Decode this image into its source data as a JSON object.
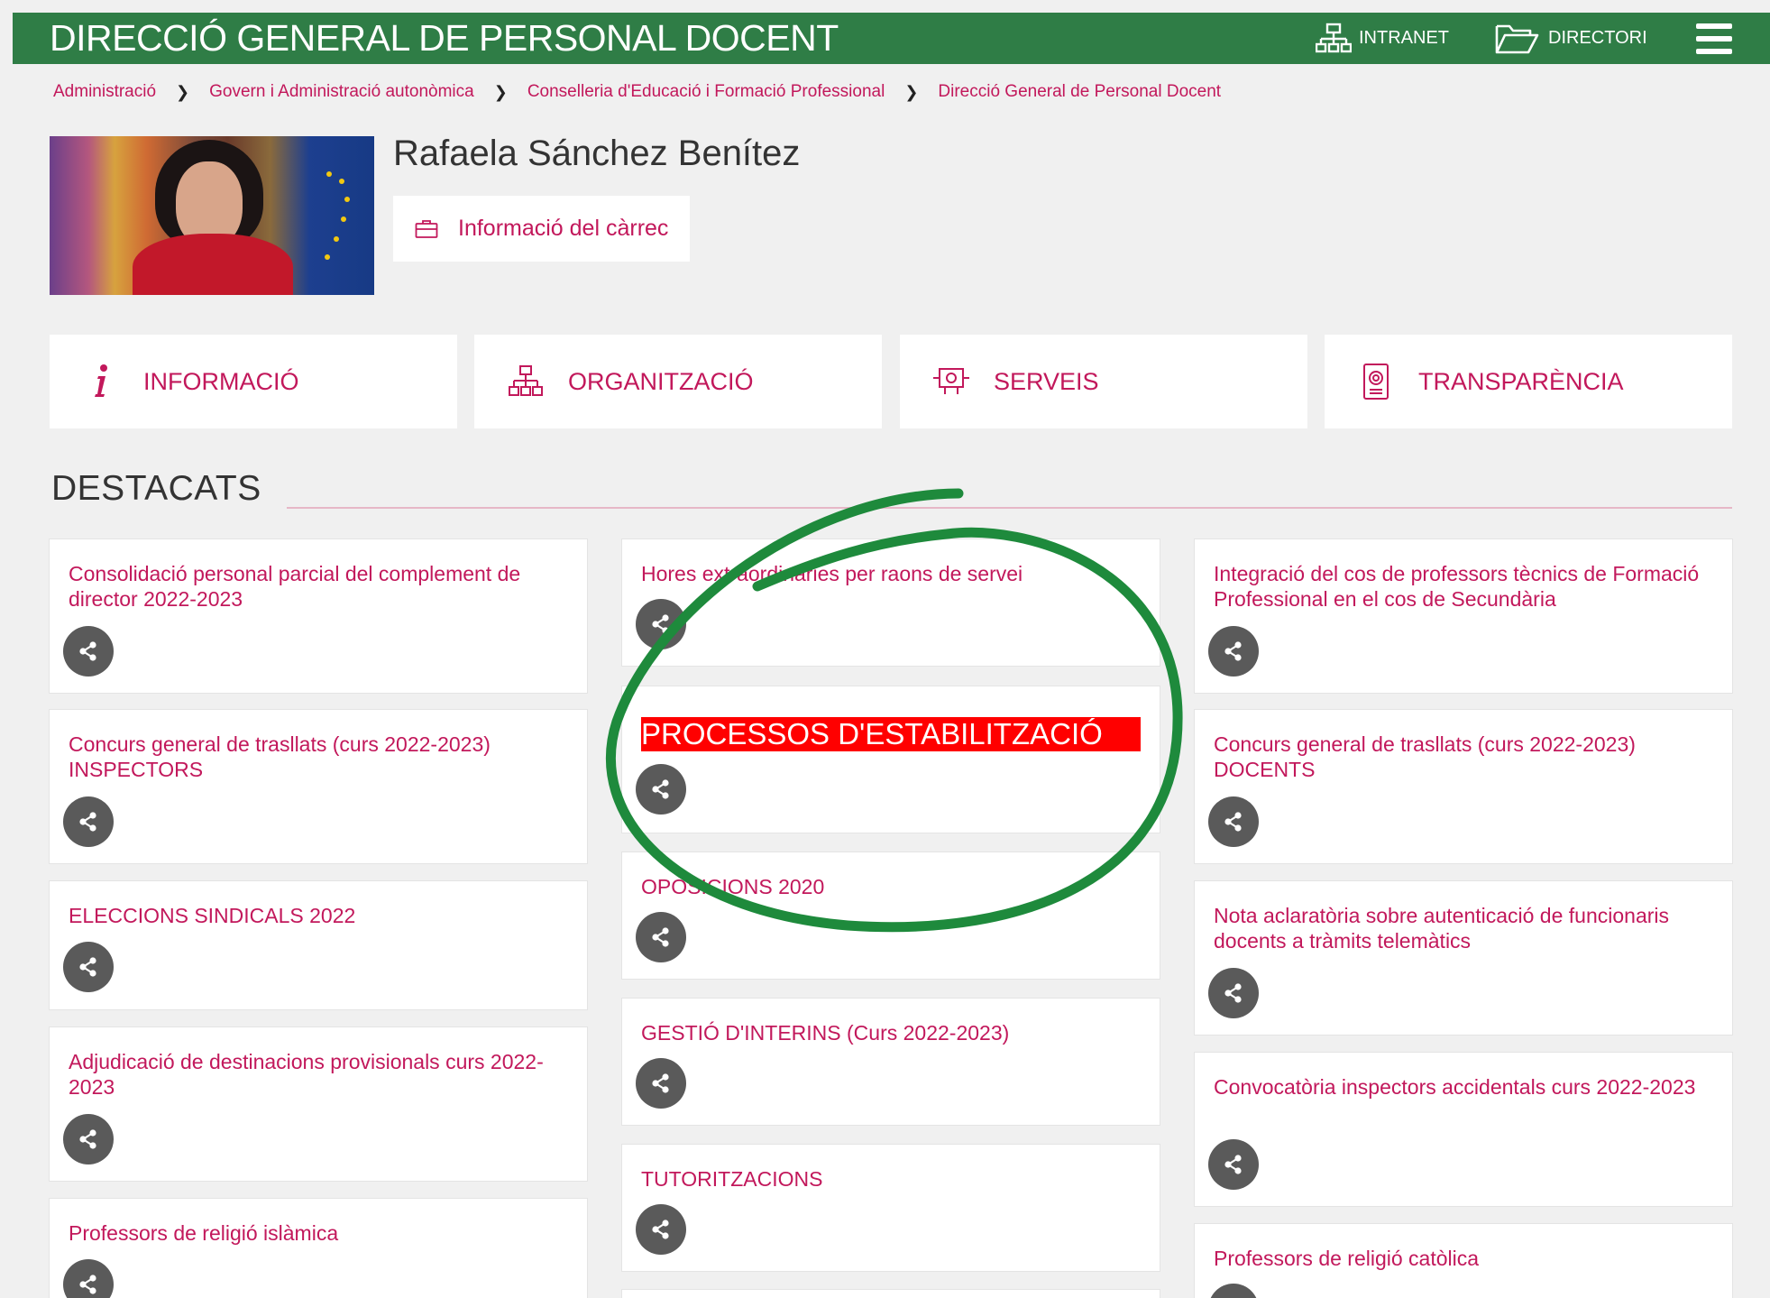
{
  "header": {
    "title": "DIRECCIÓ GENERAL DE PERSONAL DOCENT",
    "intranet_label": "INTRANET",
    "directori_label": "DIRECTORI"
  },
  "breadcrumb": [
    "Administració",
    "Govern i Administració autonòmica",
    "Conselleria d'Educació i Formació Professional",
    "Direcció General de Personal Docent"
  ],
  "profile": {
    "name": "Rafaela Sánchez Benítez",
    "role_button": "Informació del càrrec"
  },
  "nav": [
    {
      "label": "INFORMACIÓ",
      "icon": "info-icon"
    },
    {
      "label": "ORGANITZACIÓ",
      "icon": "org-chart-icon"
    },
    {
      "label": "SERVEIS",
      "icon": "services-icon"
    },
    {
      "label": "TRANSPARÈNCIA",
      "icon": "transparency-icon"
    }
  ],
  "highlights": {
    "title": "DESTACATS",
    "col1": [
      "Consolidació personal parcial del complement de director 2022-2023",
      "Concurs general de trasllats (curs 2022-2023) INSPECTORS",
      "ELECCIONS SINDICALS 2022",
      "Adjudicació de destinacions provisionals curs 2022-2023",
      "Professors de religió islàmica"
    ],
    "col2": [
      "Hores extraordinàries per raons de servei",
      "PROCESSOS D'ESTABILITZACIÓ",
      "OPOSICIONS 2020",
      "GESTIÓ D'INTERINS (Curs 2022-2023)",
      "TUTORITZACIONS"
    ],
    "col3": [
      "Integració del cos de professors tècnics de Formació Professional en el cos de Secundària",
      "Concurs general de trasllats (curs 2022-2023) DOCENTS",
      "Nota aclaratòria sobre autenticació de funcionaris docents a tràmits telemàtics",
      "Convocatòria inspectors accidentals curs 2022-2023",
      "Professors de religió catòlica"
    ]
  },
  "colors": {
    "header_green": "#2f7d46",
    "link_pink": "#c2185b",
    "highlight_red": "#ff0000",
    "annotation_green": "#1e8a3c",
    "share_grey": "#5a5a5a"
  }
}
